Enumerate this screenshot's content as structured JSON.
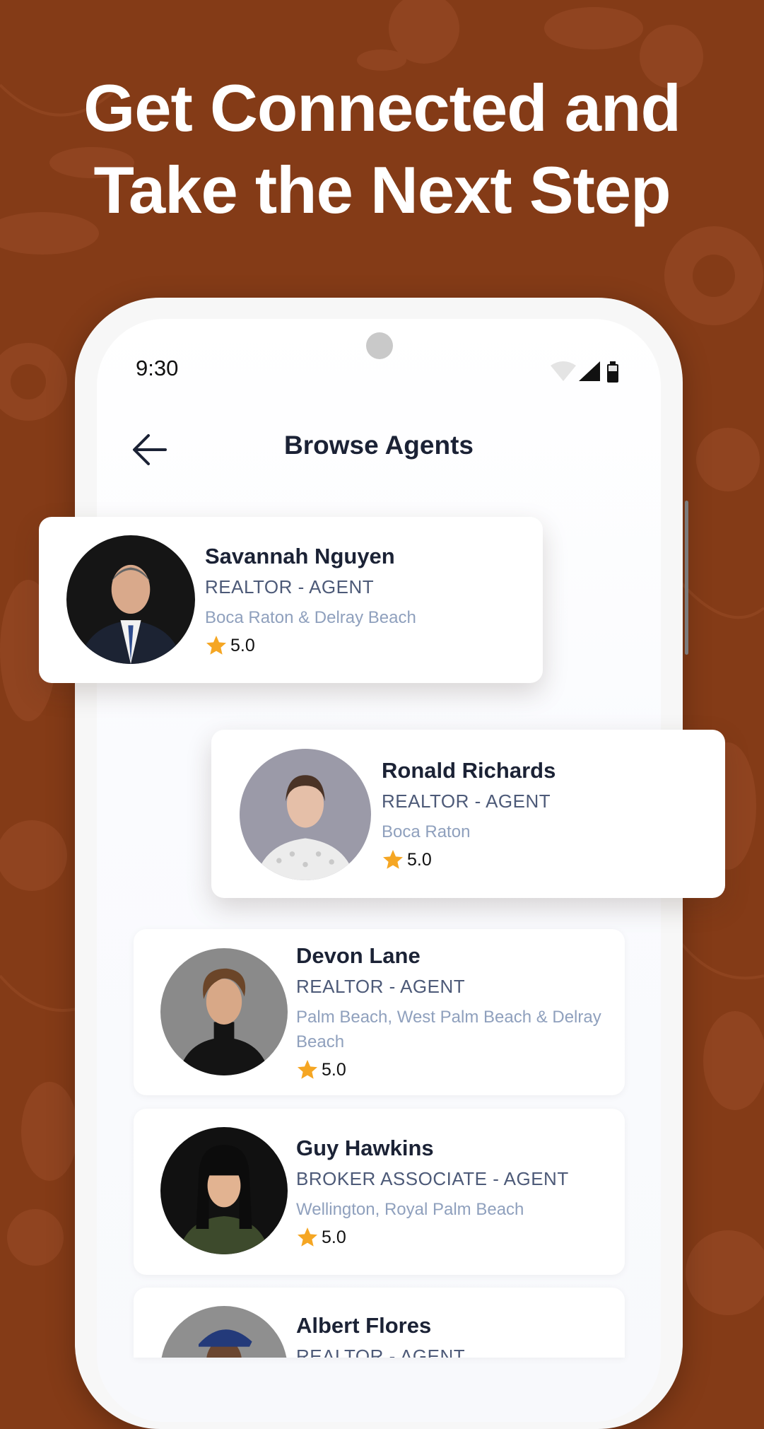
{
  "headline": {
    "line1": "Get Connected and",
    "line2": "Take the Next Step"
  },
  "status_bar": {
    "time": "9:30",
    "icons": [
      "wifi-icon",
      "signal-icon",
      "battery-icon"
    ]
  },
  "header": {
    "title": "Browse Agents",
    "back_icon": "arrow-left-icon"
  },
  "agents": [
    {
      "name": "Savannah Nguyen",
      "role": "REALTOR - AGENT",
      "location": "Boca Raton & Delray Beach",
      "rating": "5.0"
    },
    {
      "name": "Ronald Richards",
      "role": "REALTOR - AGENT",
      "location": "Boca Raton",
      "rating": "5.0"
    },
    {
      "name": "Devon Lane",
      "role": "REALTOR - AGENT",
      "location": "Palm Beach, West Palm Beach & Delray Beach",
      "rating": "5.0"
    },
    {
      "name": "Guy Hawkins",
      "role": "BROKER ASSOCIATE - AGENT",
      "location": "Wellington, Royal Palm Beach",
      "rating": "5.0"
    },
    {
      "name": "Albert Flores",
      "role": "REALTOR - AGENT",
      "location": "",
      "rating": ""
    }
  ],
  "colors": {
    "background": "#843b17",
    "title_text": "#1b2235",
    "role_text": "#4d5a78",
    "location_text": "#8fa0bd",
    "star": "#f5a623"
  }
}
